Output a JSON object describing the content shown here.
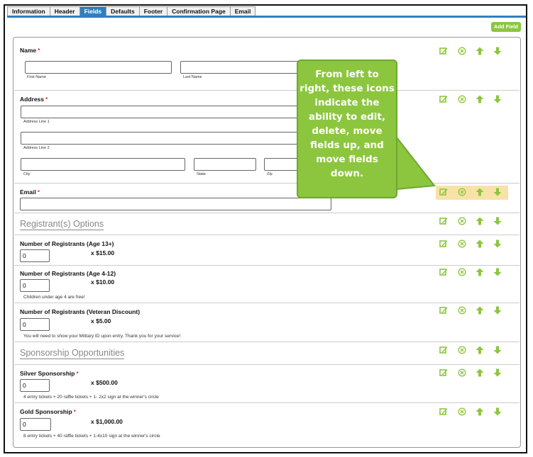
{
  "tabs": [
    {
      "label": "Information",
      "active": false
    },
    {
      "label": "Header",
      "active": false
    },
    {
      "label": "Fields",
      "active": true
    },
    {
      "label": "Defaults",
      "active": false
    },
    {
      "label": "Footer",
      "active": false
    },
    {
      "label": "Confirmation Page",
      "active": false
    },
    {
      "label": "Email",
      "active": false
    }
  ],
  "toolbar": {
    "add_field_label": "Add Field"
  },
  "required_marker": "*",
  "fields": {
    "name": {
      "label": "Name",
      "first_name": "First Name",
      "last_name": "Last Name"
    },
    "address": {
      "label": "Address",
      "line1": "Address Line 1",
      "line2": "Address Line 2",
      "city": "City",
      "state": "State",
      "zip": "Zip"
    },
    "email": {
      "label": "Email"
    },
    "registrant_options": {
      "title": "Registrant(s) Options"
    },
    "reg_adult": {
      "label": "Number of Registrants (Age 13+)",
      "value": "0",
      "price": "x $15.00"
    },
    "reg_child": {
      "label": "Number of Registrants (Age 4-12)",
      "value": "0",
      "price": "x $10.00",
      "desc": "Children under age 4 are free!"
    },
    "reg_veteran": {
      "label": "Number of Registrants (Veteran Discount)",
      "value": "0",
      "price": "x $5.00",
      "desc": "You will need to show your Military ID upon entry. Thank you for your service!"
    },
    "sponsorship": {
      "title": "Sponsorship Opportunities"
    },
    "silver": {
      "label": "Silver Sponsorship",
      "value": "0",
      "price": "x $500.00",
      "desc": "4 entry tickets + 20 raffle tickets + 1- 2x2 sign at the winner's circle"
    },
    "gold": {
      "label": "Gold Sponsorship",
      "value": "0",
      "price": "x $1,000.00",
      "desc": "8 entry tickets + 40 raffle tickets + 1-4x10 sign at the winner's circle"
    }
  },
  "row_icons": [
    "edit-icon",
    "delete-icon",
    "move-up-icon",
    "move-down-icon"
  ],
  "callout": {
    "lines": [
      "From left to",
      "right, these icons",
      "indicate the",
      "ability to edit,",
      "delete, move",
      "fields up, and",
      "move fields",
      "down."
    ]
  },
  "colors": {
    "accent_green": "#8cc63f",
    "tab_blue": "#2f7fbf",
    "highlight": "#f9e2a8",
    "required_red": "#e03030"
  }
}
